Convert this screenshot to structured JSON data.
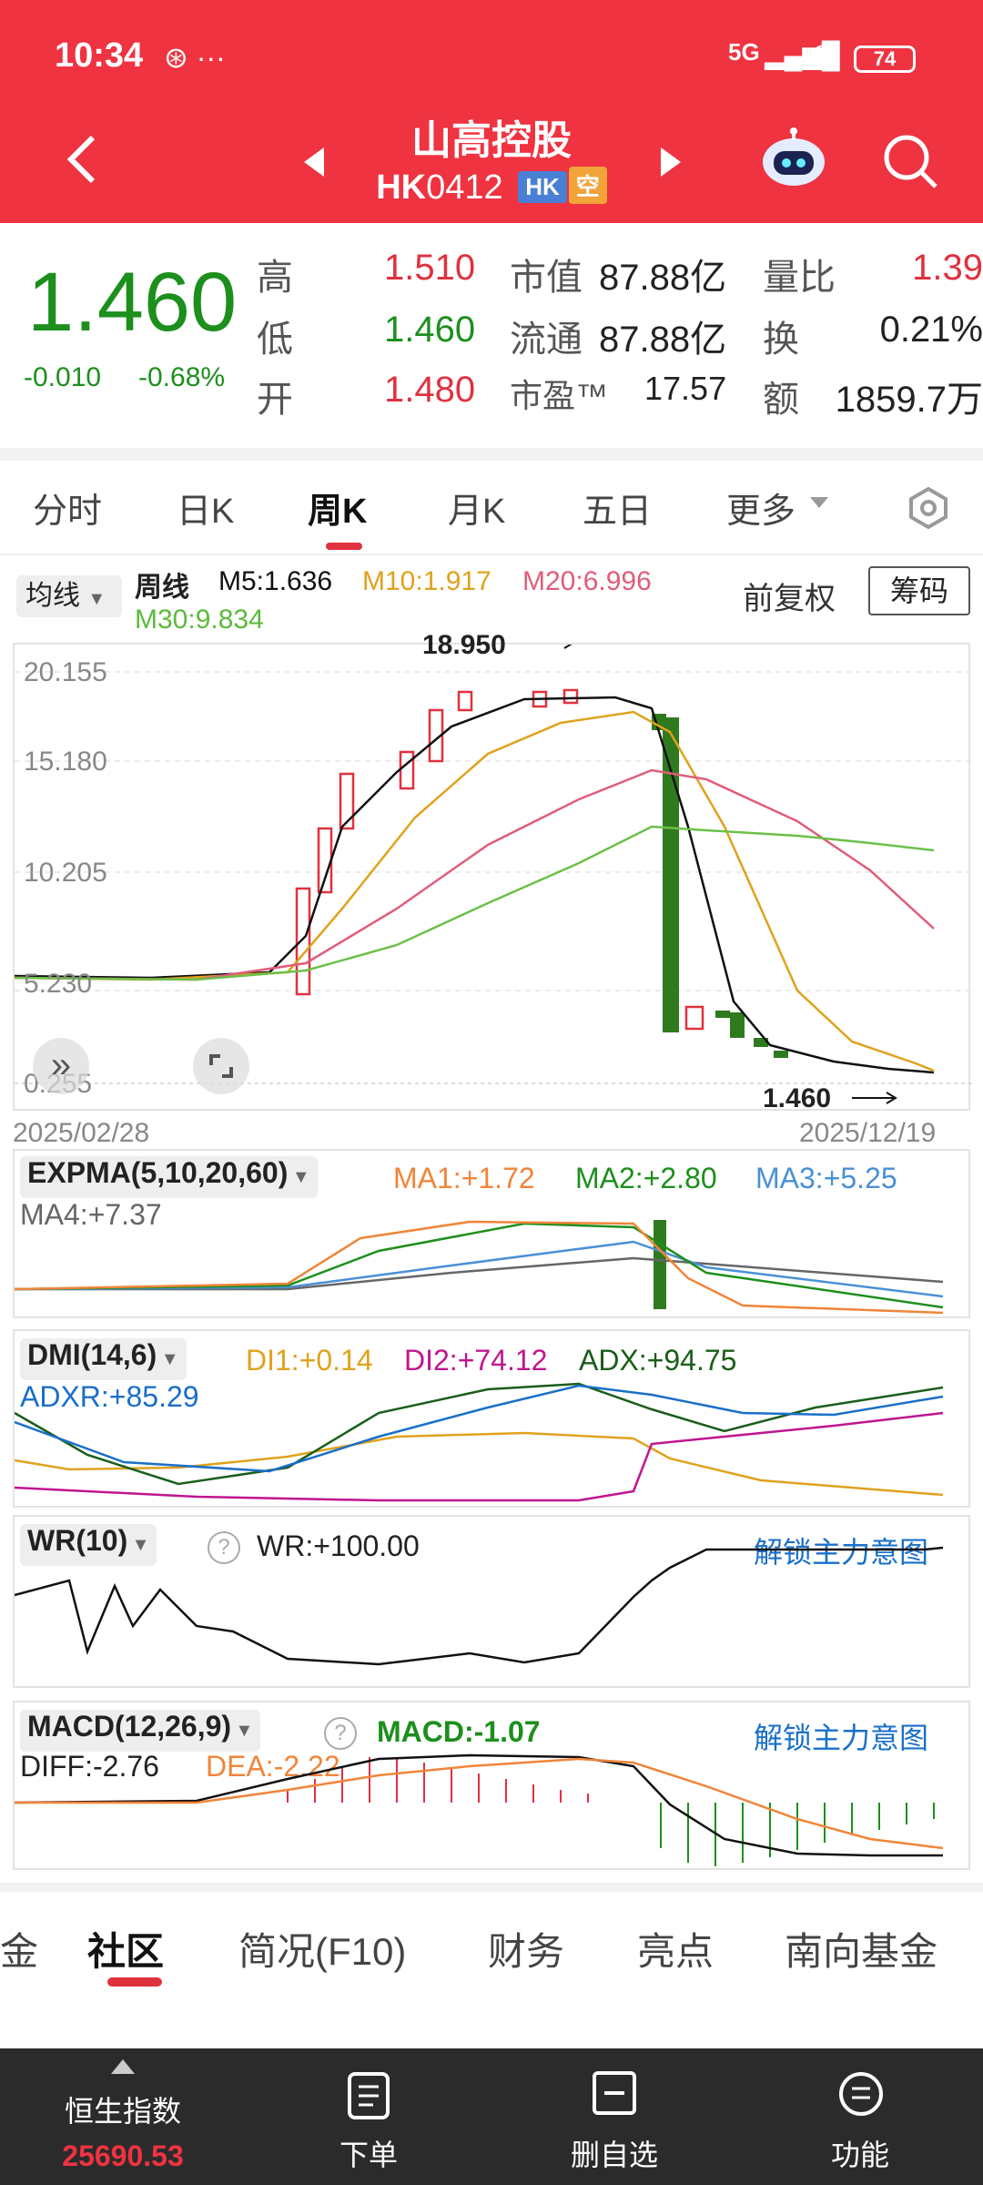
{
  "status": {
    "time": "10:34",
    "network": "5G",
    "battery": "74"
  },
  "header": {
    "name": "山高控股",
    "code_prefix": "HK",
    "code_num": "0412",
    "tag_market": "HK",
    "tag_short": "空"
  },
  "quote": {
    "price": "1.460",
    "change": "-0.010",
    "change_pct": "-0.68%",
    "high_label": "高",
    "high": "1.510",
    "low_label": "低",
    "low": "1.460",
    "open_label": "开",
    "open": "1.480",
    "mktcap_label": "市值",
    "mktcap": "87.88亿",
    "float_label": "流通",
    "float": "87.88亿",
    "pe_label": "市盈™",
    "pe": "17.57",
    "volratio_label": "量比",
    "volratio": "1.39",
    "turnover_label": "换",
    "turnover": "0.21%",
    "amount_label": "额",
    "amount": "1859.7万"
  },
  "period_tabs": [
    "分时",
    "日K",
    "周K",
    "月K",
    "五日",
    "更多"
  ],
  "active_tab": "周K",
  "kline": {
    "ma_select": "均线",
    "period_label": "周线",
    "m5": "M5:1.636",
    "m10": "M10:1.917",
    "m20": "M20:6.996",
    "m30": "M30:9.834",
    "adjust": "前复权",
    "chip_button": "筹码",
    "high_mark": "18.950",
    "low_mark": "1.460",
    "y_ticks": [
      "20.155",
      "15.180",
      "10.205",
      "5.230",
      "0.255"
    ],
    "date_start": "2025/02/28",
    "date_end": "2025/12/19"
  },
  "expma": {
    "title": "EXPMA(5,10,20,60)",
    "ma1": "MA1:+1.72",
    "ma2": "MA2:+2.80",
    "ma3": "MA3:+5.25",
    "ma4": "MA4:+7.37"
  },
  "dmi": {
    "title": "DMI(14,6)",
    "di1": "DI1:+0.14",
    "di2": "DI2:+74.12",
    "adx": "ADX:+94.75",
    "adxr": "ADXR:+85.29"
  },
  "wr": {
    "title": "WR(10)",
    "value": "WR:+100.00",
    "unlock": "解锁主力意图"
  },
  "macd": {
    "title": "MACD(12,26,9)",
    "macd": "MACD:-1.07",
    "diff": "DIFF:-2.76",
    "dea": "DEA:-2.22",
    "unlock": "解锁主力意图"
  },
  "section_tabs": [
    "金",
    "社区",
    "简况(F10)",
    "财务",
    "亮点",
    "南向基金"
  ],
  "bottom_nav": {
    "index_name": "恒生指数",
    "index_value": "25690.53",
    "order": "下单",
    "watch": "删自选",
    "func": "功能"
  },
  "colors": {
    "up": "#e0313f",
    "down": "#1d8f1d",
    "header": "#ef3341"
  }
}
